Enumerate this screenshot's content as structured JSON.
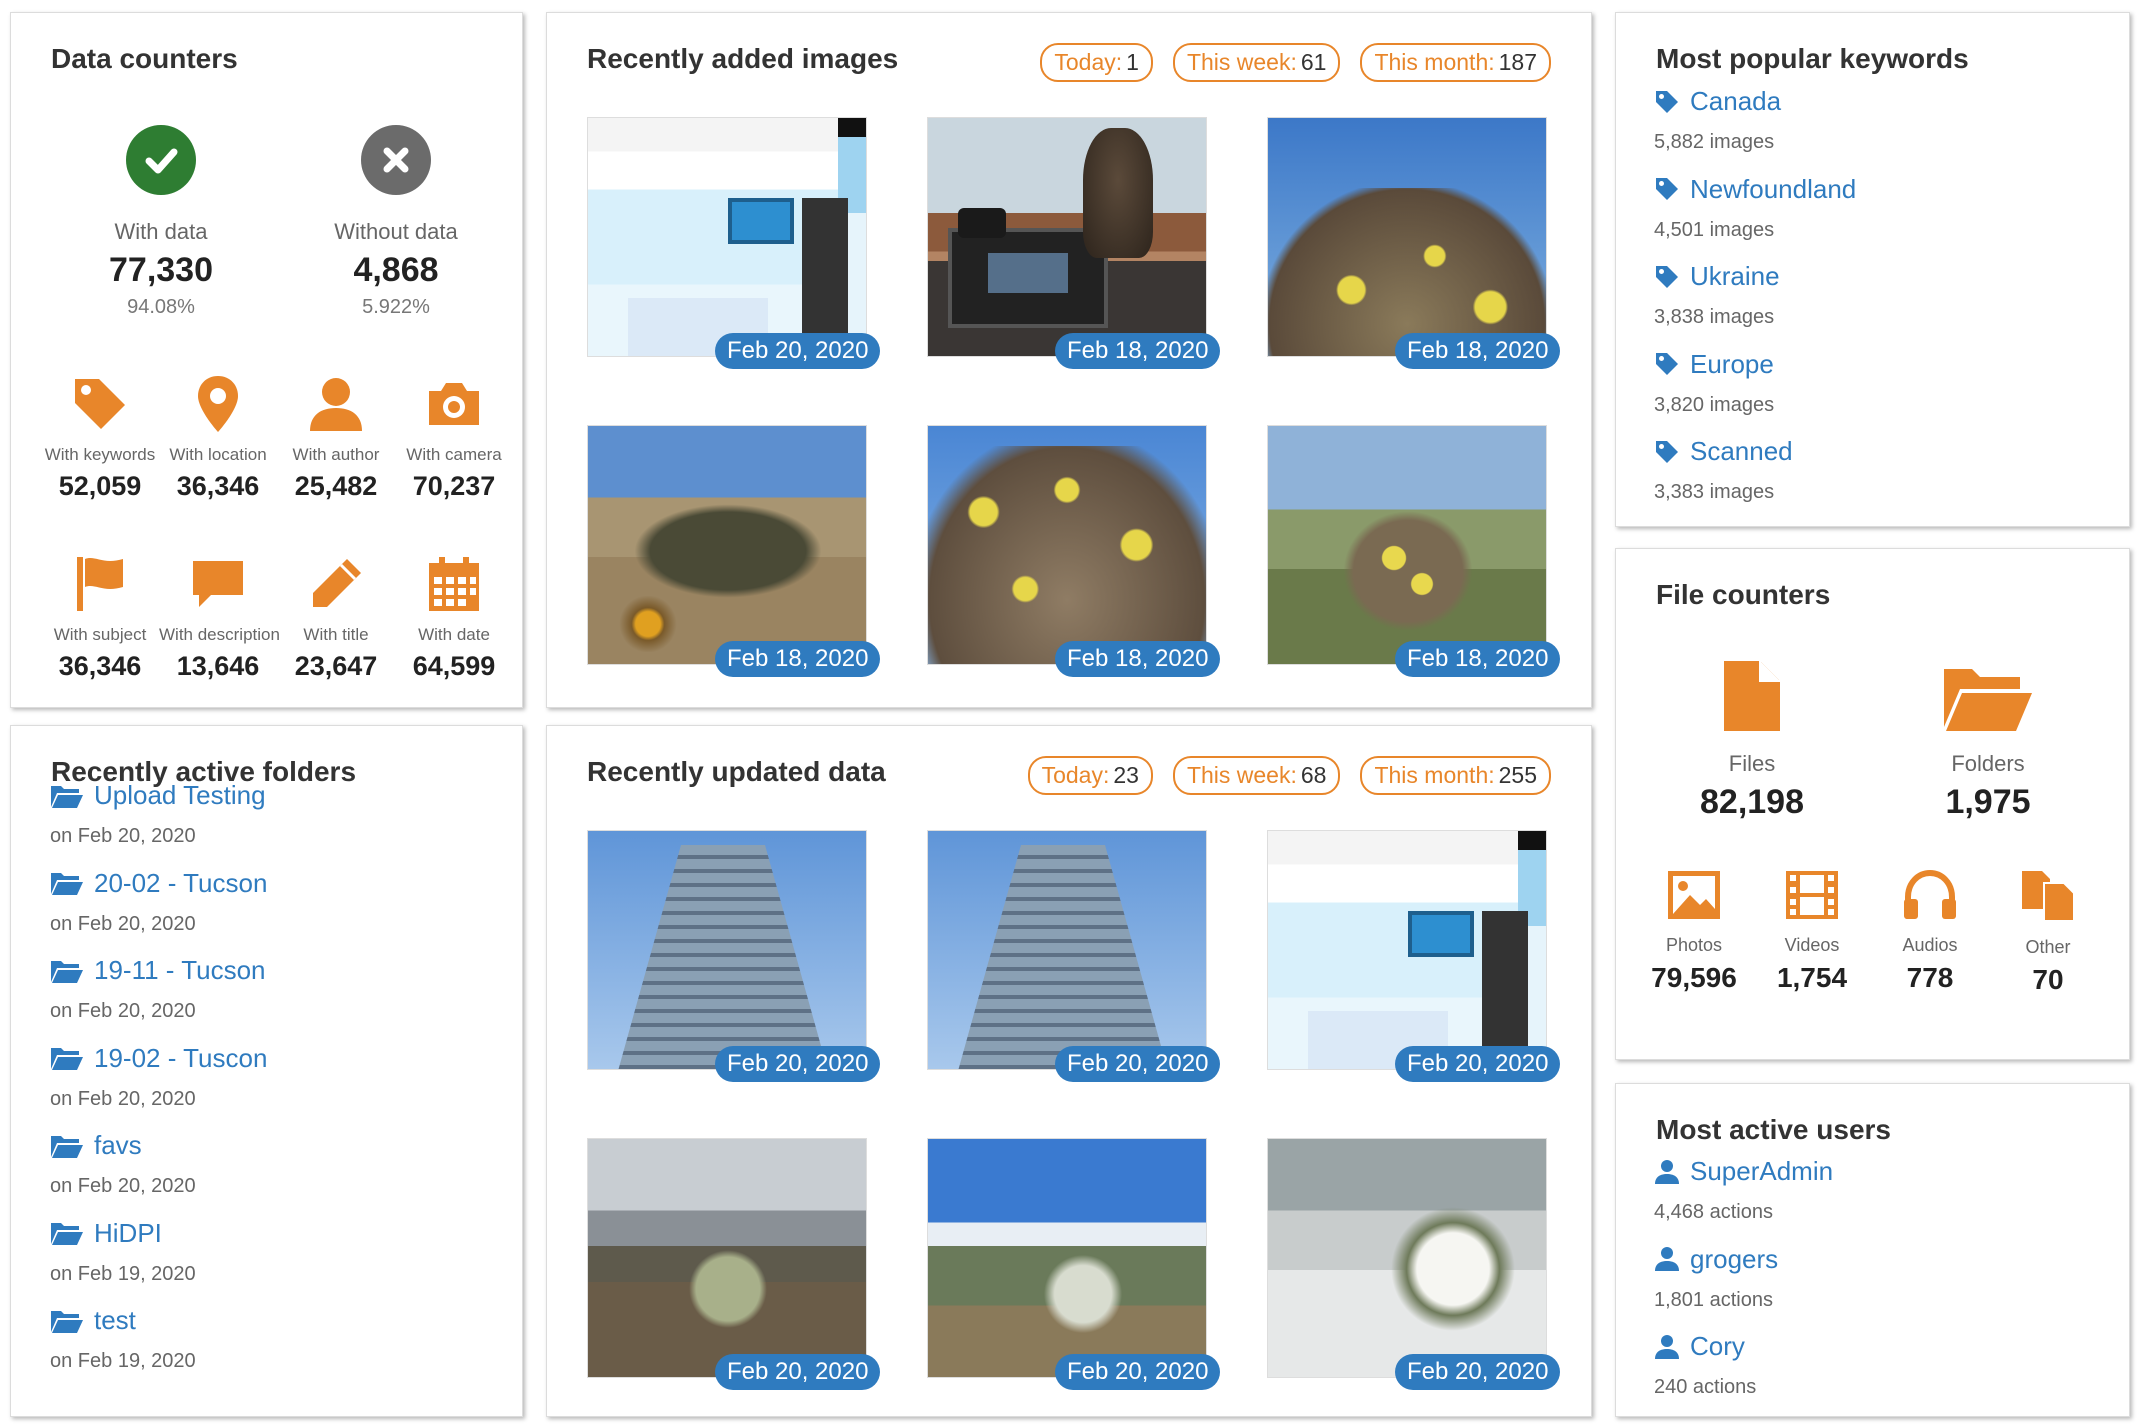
{
  "colors": {
    "accent": "#e8862a",
    "link": "#2f7bbf",
    "success": "#2e7d32",
    "muted": "#6b6b6b"
  },
  "data_counters": {
    "title": "Data counters",
    "with_data": {
      "label": "With data",
      "value": "77,330",
      "percent": "94.08%",
      "icon": "check-circle-icon"
    },
    "without_data": {
      "label": "Without data",
      "value": "4,868",
      "percent": "5.922%",
      "icon": "x-circle-icon"
    },
    "small": [
      {
        "label": "With keywords",
        "value": "52,059",
        "icon": "tag-icon"
      },
      {
        "label": "With location",
        "value": "36,346",
        "icon": "map-pin-icon"
      },
      {
        "label": "With author",
        "value": "25,482",
        "icon": "user-icon"
      },
      {
        "label": "With camera",
        "value": "70,237",
        "icon": "camera-icon"
      },
      {
        "label": "With subject",
        "value": "36,346",
        "icon": "flag-icon"
      },
      {
        "label": "With description",
        "value": "13,646",
        "icon": "comment-icon"
      },
      {
        "label": "With title",
        "value": "23,647",
        "icon": "pencil-icon"
      },
      {
        "label": "With date",
        "value": "64,599",
        "icon": "calendar-icon"
      }
    ]
  },
  "recent_images": {
    "title": "Recently added images",
    "pills": [
      {
        "label": "Today:",
        "value": "1"
      },
      {
        "label": "This week:",
        "value": "61"
      },
      {
        "label": "This month:",
        "value": "187"
      }
    ],
    "thumbs": [
      {
        "date": "Feb 20, 2020",
        "kind": "screenshot"
      },
      {
        "date": "Feb 18, 2020",
        "kind": "cat-window"
      },
      {
        "date": "Feb 18, 2020",
        "kind": "cactus-sky"
      },
      {
        "date": "Feb 18, 2020",
        "kind": "desert-cactus"
      },
      {
        "date": "Feb 18, 2020",
        "kind": "cactus-flowers"
      },
      {
        "date": "Feb 18, 2020",
        "kind": "cactus-blur"
      }
    ]
  },
  "recent_data": {
    "title": "Recently updated data",
    "pills": [
      {
        "label": "Today:",
        "value": "23"
      },
      {
        "label": "This week:",
        "value": "68"
      },
      {
        "label": "This month:",
        "value": "255"
      }
    ],
    "thumbs": [
      {
        "date": "Feb 20, 2020",
        "kind": "tower"
      },
      {
        "date": "Feb 20, 2020",
        "kind": "tower"
      },
      {
        "date": "Feb 20, 2020",
        "kind": "screenshot"
      },
      {
        "date": "Feb 20, 2020",
        "kind": "cloudy-desert"
      },
      {
        "date": "Feb 20, 2020",
        "kind": "snow-mountain"
      },
      {
        "date": "Feb 20, 2020",
        "kind": "snow-cactus"
      }
    ]
  },
  "folders": {
    "title": "Recently active folders",
    "items": [
      {
        "name": "Upload Testing",
        "date": "on Feb 20, 2020"
      },
      {
        "name": "20-02 - Tucson",
        "date": "on Feb 20, 2020"
      },
      {
        "name": "19-11 - Tucson",
        "date": "on Feb 20, 2020"
      },
      {
        "name": "19-02 - Tuscon",
        "date": "on Feb 20, 2020"
      },
      {
        "name": "favs",
        "date": "on Feb 20, 2020"
      },
      {
        "name": "HiDPI",
        "date": "on Feb 19, 2020"
      },
      {
        "name": "test",
        "date": "on Feb 19, 2020"
      }
    ]
  },
  "keywords": {
    "title": "Most popular keywords",
    "items": [
      {
        "name": "Canada",
        "count": "5,882 images"
      },
      {
        "name": "Newfoundland",
        "count": "4,501 images"
      },
      {
        "name": "Ukraine",
        "count": "3,838 images"
      },
      {
        "name": "Europe",
        "count": "3,820 images"
      },
      {
        "name": "Scanned",
        "count": "3,383 images"
      }
    ]
  },
  "file_counters": {
    "title": "File counters",
    "files": {
      "label": "Files",
      "value": "82,198",
      "icon": "file-icon"
    },
    "folders": {
      "label": "Folders",
      "value": "1,975",
      "icon": "folder-open-icon"
    },
    "small": [
      {
        "label": "Photos",
        "value": "79,596",
        "icon": "image-icon"
      },
      {
        "label": "Videos",
        "value": "1,754",
        "icon": "film-icon"
      },
      {
        "label": "Audios",
        "value": "778",
        "icon": "headphones-icon"
      },
      {
        "label": "Other",
        "value": "70",
        "icon": "files-icon"
      }
    ]
  },
  "users": {
    "title": "Most active users",
    "items": [
      {
        "name": "SuperAdmin",
        "actions": "4,468 actions"
      },
      {
        "name": "grogers",
        "actions": "1,801 actions"
      },
      {
        "name": "Cory",
        "actions": "240 actions"
      }
    ]
  }
}
